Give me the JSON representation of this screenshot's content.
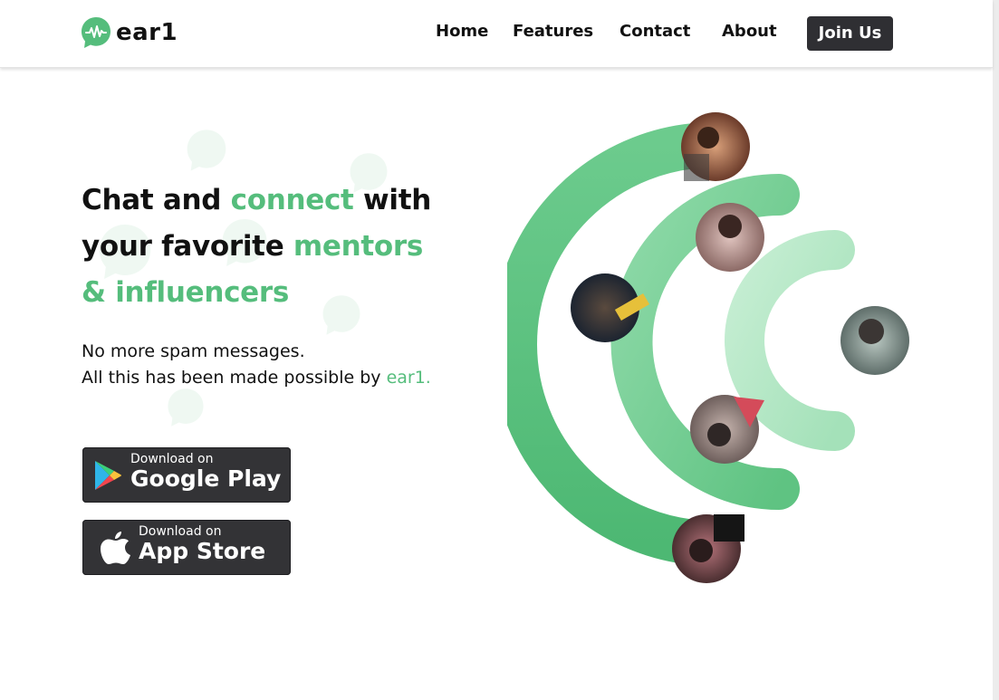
{
  "brand": {
    "name": "ear1",
    "color": "#55bd7c"
  },
  "nav": {
    "items": [
      "Home",
      "Features",
      "Contact",
      "About"
    ],
    "cta": "Join Us"
  },
  "hero": {
    "headline": {
      "l1a": "Chat and ",
      "l1b": "connect",
      "l1c": " with",
      "l2a": "your favorite ",
      "l2b": "mentors",
      "l3": "& influencers"
    },
    "sub1": "No more spam messages.",
    "sub2a": "All this has been made possible by ",
    "sub2b": "ear1."
  },
  "stores": {
    "google": {
      "small": "Download on",
      "big": "Google Play"
    },
    "apple": {
      "small": "Download on",
      "big": "App Store"
    }
  },
  "icons": {
    "logo": "chat-bubble-waveform-icon",
    "google": "google-play-icon",
    "apple": "apple-icon"
  }
}
